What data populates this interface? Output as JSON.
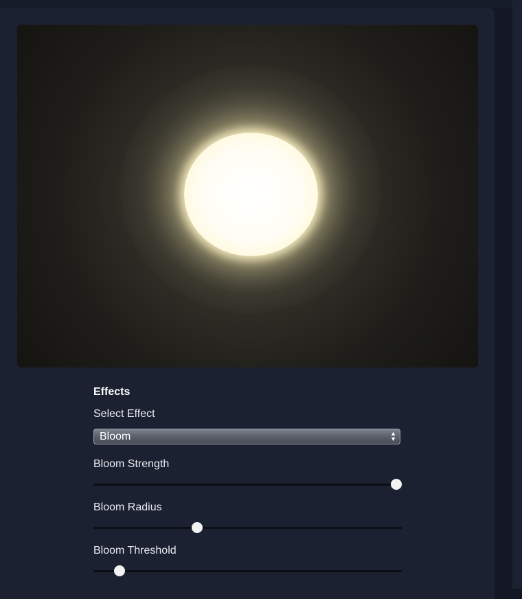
{
  "effects": {
    "title": "Effects",
    "select_label": "Select Effect",
    "select_value": "Bloom",
    "sliders": [
      {
        "label": "Bloom Strength",
        "fraction": 1.0
      },
      {
        "label": "Bloom Radius",
        "fraction": 0.33
      },
      {
        "label": "Bloom Threshold",
        "fraction": 0.07
      }
    ]
  }
}
